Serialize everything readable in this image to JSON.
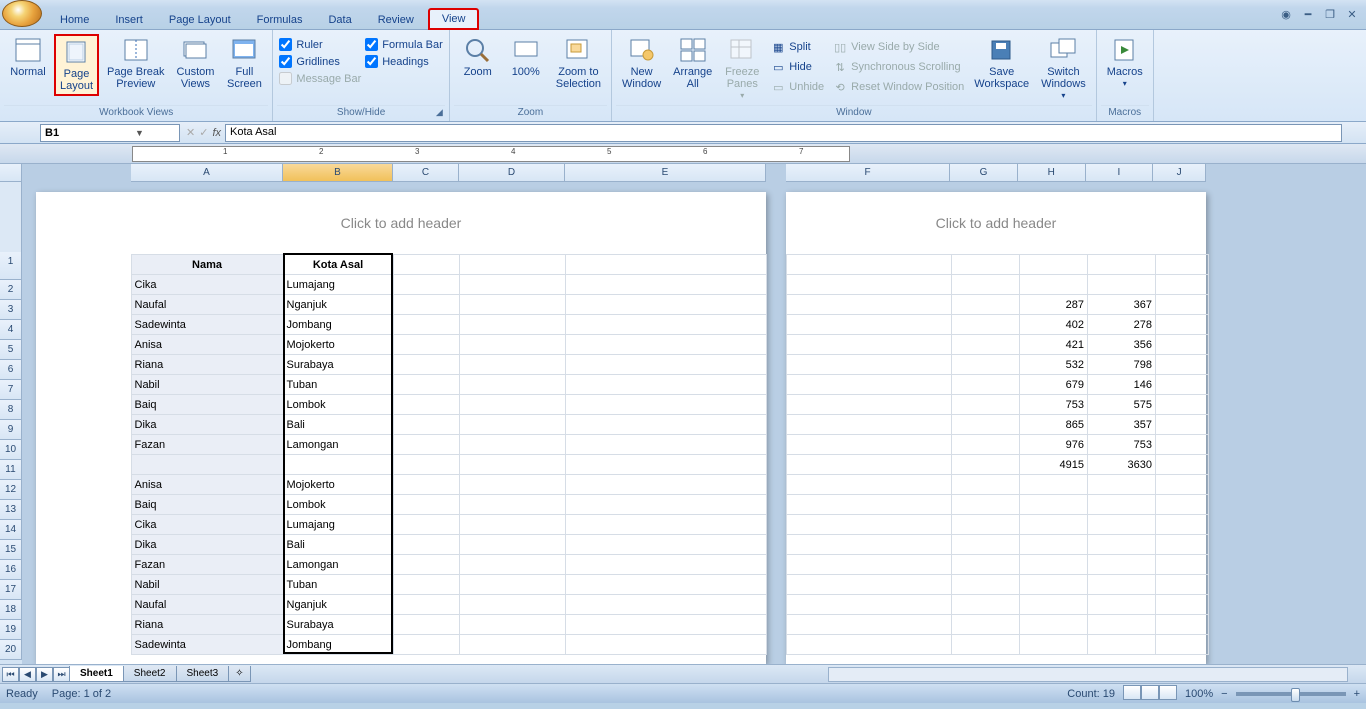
{
  "tabs": [
    "Home",
    "Insert",
    "Page Layout",
    "Formulas",
    "Data",
    "Review",
    "View"
  ],
  "active_tab": "View",
  "ribbon": {
    "views": {
      "normal": "Normal",
      "page_layout": "Page\nLayout",
      "page_break": "Page Break\nPreview",
      "custom": "Custom\nViews",
      "full": "Full\nScreen",
      "label": "Workbook Views"
    },
    "showhide": {
      "ruler": "Ruler",
      "gridlines": "Gridlines",
      "message_bar": "Message Bar",
      "formula_bar": "Formula Bar",
      "headings": "Headings",
      "label": "Show/Hide"
    },
    "zoom": {
      "zoom": "Zoom",
      "hundred": "100%",
      "to_sel": "Zoom to\nSelection",
      "label": "Zoom"
    },
    "window": {
      "new": "New\nWindow",
      "arrange": "Arrange\nAll",
      "freeze": "Freeze\nPanes",
      "split": "Split",
      "hide": "Hide",
      "unhide": "Unhide",
      "side": "View Side by Side",
      "sync": "Synchronous Scrolling",
      "reset": "Reset Window Position",
      "save_ws": "Save\nWorkspace",
      "switch": "Switch\nWindows",
      "label": "Window"
    },
    "macros": {
      "macros": "Macros",
      "label": "Macros"
    }
  },
  "namebox": "B1",
  "formula": "Kota Asal",
  "columns_p1": [
    "A",
    "B",
    "C",
    "D",
    "E"
  ],
  "columns_p2": [
    "F",
    "G",
    "H",
    "I",
    "J"
  ],
  "header_placeholder": "Click to add header",
  "rows": [
    1,
    2,
    3,
    4,
    5,
    6,
    7,
    8,
    9,
    10,
    11,
    12,
    13,
    14,
    15,
    16,
    17,
    18,
    19,
    20
  ],
  "data_p1": [
    {
      "a": "Nama",
      "b": "Kota Asal",
      "hdr": true
    },
    {
      "a": "Cika",
      "b": "Lumajang"
    },
    {
      "a": "Naufal",
      "b": "Nganjuk"
    },
    {
      "a": "Sadewinta",
      "b": "Jombang"
    },
    {
      "a": "Anisa",
      "b": "Mojokerto"
    },
    {
      "a": "Riana",
      "b": "Surabaya"
    },
    {
      "a": "Nabil",
      "b": "Tuban"
    },
    {
      "a": "Baiq",
      "b": "Lombok"
    },
    {
      "a": "Dika",
      "b": "Bali"
    },
    {
      "a": "Fazan",
      "b": "Lamongan"
    },
    {
      "a": "",
      "b": ""
    },
    {
      "a": "Anisa",
      "b": "Mojokerto"
    },
    {
      "a": "Baiq",
      "b": "Lombok"
    },
    {
      "a": "Cika",
      "b": "Lumajang"
    },
    {
      "a": "Dika",
      "b": "Bali"
    },
    {
      "a": "Fazan",
      "b": "Lamongan"
    },
    {
      "a": "Nabil",
      "b": "Tuban"
    },
    {
      "a": "Naufal",
      "b": "Nganjuk"
    },
    {
      "a": "Riana",
      "b": "Surabaya"
    },
    {
      "a": "Sadewinta",
      "b": "Jombang"
    }
  ],
  "data_p2": [
    {
      "g": "",
      "h": "",
      "i": ""
    },
    {
      "g": "",
      "h": "",
      "i": ""
    },
    {
      "g": "",
      "h": "287",
      "i": "367"
    },
    {
      "g": "",
      "h": "402",
      "i": "278"
    },
    {
      "g": "",
      "h": "421",
      "i": "356"
    },
    {
      "g": "",
      "h": "532",
      "i": "798"
    },
    {
      "g": "",
      "h": "679",
      "i": "146"
    },
    {
      "g": "",
      "h": "753",
      "i": "575"
    },
    {
      "g": "",
      "h": "865",
      "i": "357"
    },
    {
      "g": "",
      "h": "976",
      "i": "753"
    },
    {
      "g": "",
      "h": "4915",
      "i": "3630"
    },
    {
      "g": "",
      "h": "",
      "i": ""
    },
    {
      "g": "",
      "h": "",
      "i": ""
    },
    {
      "g": "",
      "h": "",
      "i": ""
    },
    {
      "g": "",
      "h": "",
      "i": ""
    },
    {
      "g": "",
      "h": "",
      "i": ""
    },
    {
      "g": "",
      "h": "",
      "i": ""
    },
    {
      "g": "",
      "h": "",
      "i": ""
    },
    {
      "g": "",
      "h": "",
      "i": ""
    },
    {
      "g": "",
      "h": "",
      "i": ""
    }
  ],
  "sheets": [
    "Sheet1",
    "Sheet2",
    "Sheet3"
  ],
  "status": {
    "ready": "Ready",
    "page": "Page: 1 of 2",
    "count": "Count: 19",
    "zoom": "100%"
  }
}
